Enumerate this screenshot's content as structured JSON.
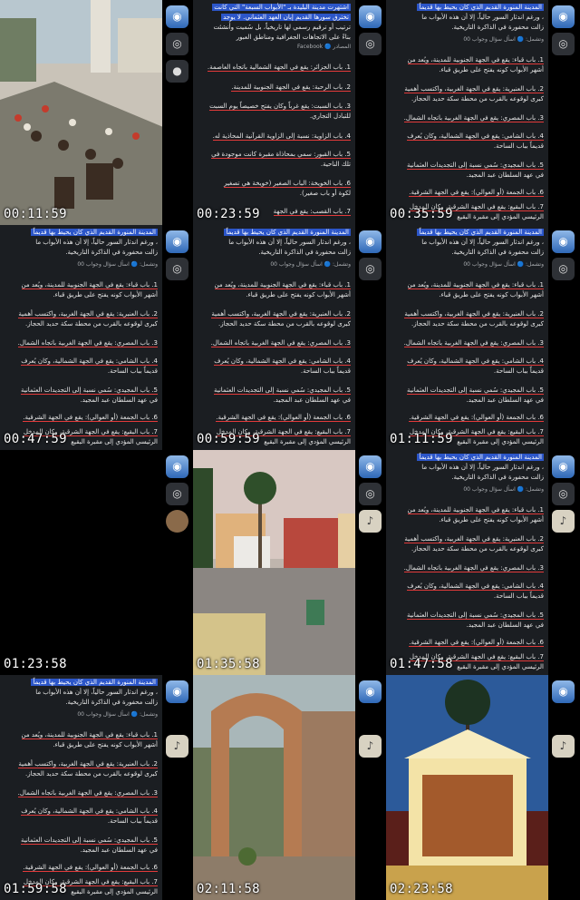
{
  "timestamps": [
    "00:11:59",
    "00:23:59",
    "00:35:59",
    "00:47:59",
    "00:59:59",
    "01:11:59",
    "01:23:58",
    "01:35:58",
    "01:47:58",
    "01:59:58",
    "02:11:58",
    "02:23:58"
  ],
  "chat_medina": {
    "heading": "المدينة المنورة القديم الذي كان يحيط بها قديماً",
    "heading2": "لحمايتها",
    "intro_rest": "، ورغم اندثار السور حالياً، إلا أن هذه الأبواب ما",
    "intro2": "زالت محفورة في الذاكرة التاريخية.",
    "meta": "وتشمل: 🔵 اسأل سؤال وجواب 00",
    "items": [
      "1. باب قباء: يقع في الجهة الجنوبية للمدينة، ويُعد من",
      "أشهر الأبواب كونه يفتح على طريق قباء.",
      "2. باب العنبرية: يقع في الجهة الغربية، واكتسب أهمية",
      "كبرى لوقوعه بالقرب من محطة سكة حديد الحجاز.",
      "3. باب المصري: يقع في الجهة الغربية باتجاه الشمال.",
      "4. باب الشامي: يقع في الجهة الشمالية، وكان يُعرف",
      "قديماً بباب الساحة.",
      "5. باب المجيدي: سُمي نسبة إلى التجديدات العثمانية",
      "في عهد السلطان عبد المجيد.",
      "6. باب الجمعة (أو العوالي): يقع في الجهة الشرقية.",
      "7. باب البقيع: يقع في الجهة الشرقية، وكان المدخل",
      "الرئيسي المؤدي إلى مقبرة البقيع"
    ]
  },
  "chat_blida": {
    "heading": "اشتهرت مدينة البليدة بـ \"الأبواب السبعة\" التي كانت",
    "heading2": "تخترق سورها القديم إبان العهد العثماني. لا يوجد",
    "intro": "ترتيب أو ترقيم رسمي لها تاريخياً، بل سُميت وأُنشئت",
    "intro2": "بناءً على الاتجاهات الجغرافية ومناطق العبور",
    "meta": "المصادر 🔵 Facebook",
    "items": [
      "1. باب الجزائر: يقع في الجهة الشمالية باتجاه العاصمة.",
      "2. باب الرحبة: يقع في الجهة الجنوبية للمدينة.",
      "3. باب السبت: يقع غرباً وكان يفتح خصيصاً يوم السبت",
      "للتبادل التجاري.",
      "4. باب الزاوية: نسبة إلى الزاوية القرآنية المحاذية له.",
      "5. باب القبور: سمي بمحاذاة مقبرة كانت موجودة في",
      "تلك الناحية.",
      "6. باب الخويخة: الباب الصغير (خويخة هي تصغير",
      "لكوة أو باب صغير).",
      "7. باب القصب: يقع في الجهة"
    ]
  },
  "rail": {
    "top_icon": "app-logo-icon",
    "second_icon": "audio-icon"
  }
}
